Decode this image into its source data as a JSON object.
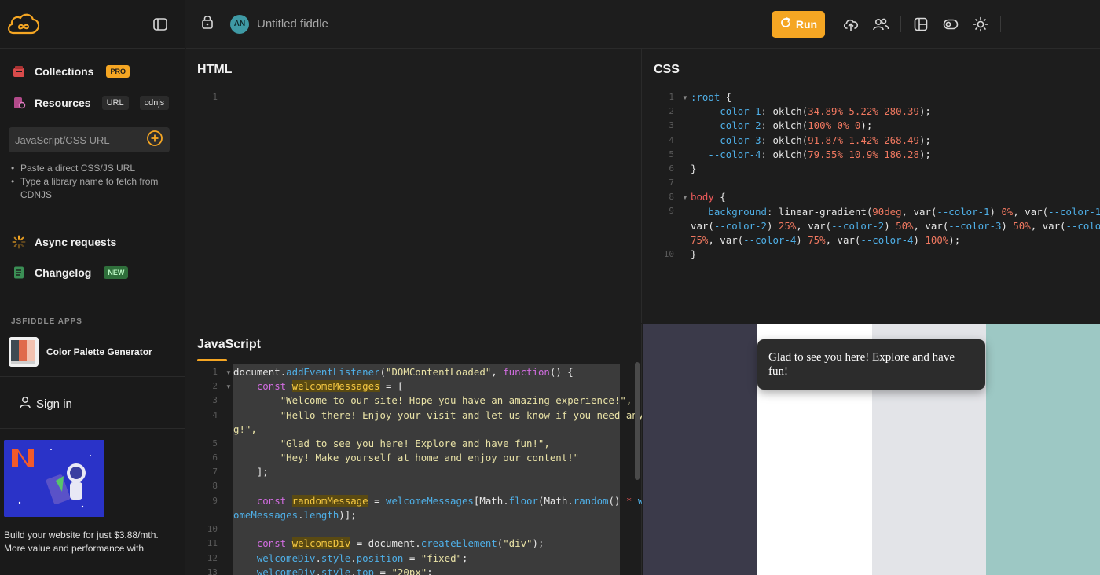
{
  "sidebar": {
    "collections_label": "Collections",
    "collections_badge": "PRO",
    "resources_label": "Resources",
    "resources_tags": [
      "URL",
      "cdnjs"
    ],
    "url_placeholder": "JavaScript/CSS URL",
    "hints": [
      "Paste a direct CSS/JS URL",
      "Type a library name to fetch from CDNJS"
    ],
    "async_label": "Async requests",
    "changelog_label": "Changelog",
    "changelog_badge": "NEW",
    "apps_title": "JSFIDDLE APPS",
    "app_name": "Color Palette Generator",
    "signin_label": "Sign in",
    "ad_text": "Build your website for just $3.88/mth. More value and performance with"
  },
  "topbar": {
    "avatar_initials": "AN",
    "fiddle_title": "Untitled fiddle",
    "run_label": "Run"
  },
  "panels": {
    "html_title": "HTML",
    "css_title": "CSS",
    "js_title": "JavaScript"
  },
  "html_code": {
    "line_numbers": [
      "1"
    ]
  },
  "css_code": {
    "line_numbers": [
      "1",
      "2",
      "3",
      "4",
      "5",
      "6",
      "7",
      "8",
      "9",
      "",
      "",
      "10"
    ],
    "root_selector": ":root",
    "vars": [
      {
        "name": "--color-1",
        "value": "34.89% 5.22% 280.39"
      },
      {
        "name": "--color-2",
        "value": "100% 0% 0"
      },
      {
        "name": "--color-3",
        "value": "91.87% 1.42% 268.49"
      },
      {
        "name": "--color-4",
        "value": "79.55% 10.9% 186.28"
      }
    ],
    "body_selector": "body",
    "background_prop": "background",
    "gradient_fn": "linear-gradient",
    "gradient_angle": "90deg"
  },
  "js_code": {
    "line_numbers": [
      "1",
      "2",
      "3",
      "4",
      "",
      "5",
      "6",
      "7",
      "8",
      "9",
      "",
      "10",
      "11",
      "12",
      "13"
    ],
    "welcome_messages": [
      "\"Welcome to our site! Hope you have an amazing experience!\",",
      "\"Hello there! Enjoy your visit and let us know if you need anythin",
      "g!\",",
      "\"Glad to see you here! Explore and have fun!\",",
      "\"Hey! Make yourself at home and enjoy our content!\""
    ]
  },
  "result": {
    "stripe_colors": [
      "#3b3a4a",
      "#ffffff",
      "#e3e4e8",
      "#9dc8c4"
    ],
    "toast_text": "Glad to see you here! Explore and have fun!"
  },
  "colors": {
    "accent": "#f5a623",
    "background": "#1d1d1d"
  }
}
